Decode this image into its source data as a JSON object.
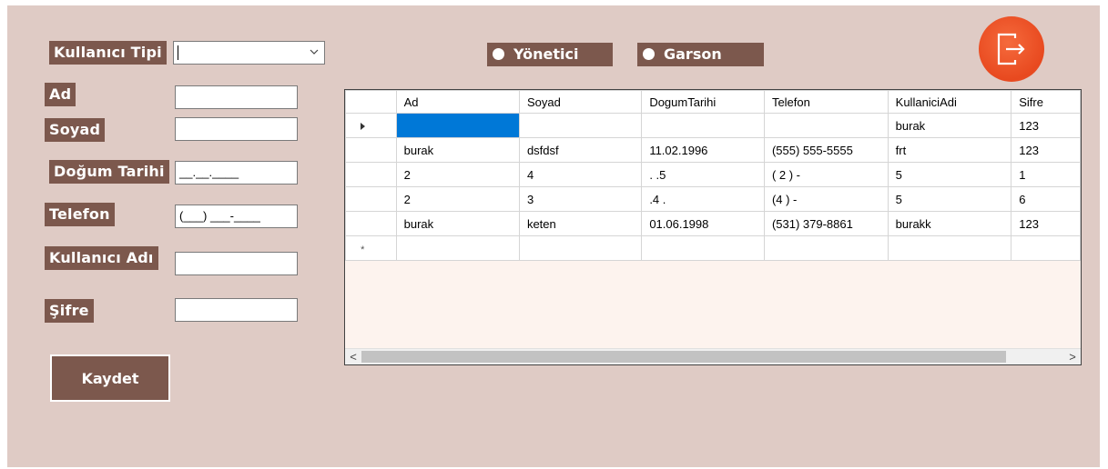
{
  "form": {
    "labels": {
      "user_type": "Kullanıcı Tipi",
      "first_name": "Ad",
      "last_name": "Soyad",
      "birth_date": "Doğum Tarihi",
      "phone": "Telefon",
      "username": "Kullanıcı Adı",
      "password": "Şifre"
    },
    "values": {
      "user_type": "",
      "first_name": "",
      "last_name": "",
      "birth_date": "__.__.____",
      "phone": "(___) ___-____",
      "username": "",
      "password": ""
    },
    "save_button": "Kaydet"
  },
  "role_options": {
    "admin": "Yönetici",
    "waiter": "Garson"
  },
  "exit_icon": "logout-icon",
  "grid": {
    "columns": [
      "Ad",
      "Soyad",
      "DogumTarihi",
      "Telefon",
      "KullaniciAdi",
      "Sifre"
    ],
    "rows": [
      [
        "",
        "",
        "",
        "",
        "burak",
        "123"
      ],
      [
        "burak",
        "dsfdsf",
        "11.02.1996",
        "(555) 555-5555",
        "frt",
        "123"
      ],
      [
        "2",
        "4",
        "  . .5",
        "( 2 )  -",
        "5",
        "1"
      ],
      [
        "2",
        "3",
        " .4 .",
        "(4  )  -",
        "5",
        "6"
      ],
      [
        "burak",
        "keten",
        "01.06.1998",
        "(531) 379-8861",
        "burakk",
        "123"
      ]
    ],
    "new_row_marker": "*",
    "scroll_left": "<",
    "scroll_right": ">"
  },
  "colors": {
    "form_background": "#dfcbc5",
    "label_background": "#7c584d",
    "exit_button": "#e8491f",
    "selected_cell": "#0078d7"
  }
}
